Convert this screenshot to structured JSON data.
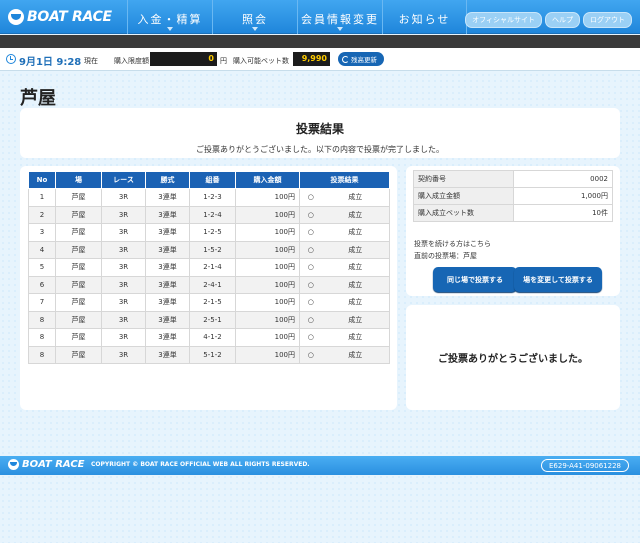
{
  "header": {
    "logo_text": "BOAT RACE",
    "nav": [
      {
        "label": "入金・精算",
        "caret": true
      },
      {
        "label": "照会",
        "caret": true
      },
      {
        "label": "会員情報変更",
        "caret": true
      },
      {
        "label": "お知らせ",
        "caret": false
      }
    ],
    "util": [
      "オフィシャルサイト",
      "ヘルプ",
      "ログアウト"
    ]
  },
  "infobar": {
    "datetime": "9月1日 9:28",
    "datetime_suffix": "現在",
    "limit_label": "購入限度額",
    "limit_value": "0",
    "limit_unit": "円",
    "bets_label": "購入可能ベット数",
    "bets_value": "9,990",
    "refresh_label": "残高更新"
  },
  "page_title": "芦屋",
  "result": {
    "title": "投票結果",
    "message": "ご投票ありがとうございました。以下の内容で投票が完了しました。"
  },
  "table": {
    "headers": [
      "No",
      "場",
      "レース",
      "勝式",
      "組番",
      "購入金額",
      "投票結果"
    ],
    "rows": [
      [
        "1",
        "芦屋",
        "3R",
        "3連単",
        "1-2-3",
        "100円",
        "○",
        "成立"
      ],
      [
        "2",
        "芦屋",
        "3R",
        "3連単",
        "1-2-4",
        "100円",
        "○",
        "成立"
      ],
      [
        "3",
        "芦屋",
        "3R",
        "3連単",
        "1-2-5",
        "100円",
        "○",
        "成立"
      ],
      [
        "4",
        "芦屋",
        "3R",
        "3連単",
        "1-5-2",
        "100円",
        "○",
        "成立"
      ],
      [
        "5",
        "芦屋",
        "3R",
        "3連単",
        "2-1-4",
        "100円",
        "○",
        "成立"
      ],
      [
        "6",
        "芦屋",
        "3R",
        "3連単",
        "2-4-1",
        "100円",
        "○",
        "成立"
      ],
      [
        "7",
        "芦屋",
        "3R",
        "3連単",
        "2-1-5",
        "100円",
        "○",
        "成立"
      ],
      [
        "8",
        "芦屋",
        "3R",
        "3連単",
        "2-5-1",
        "100円",
        "○",
        "成立"
      ],
      [
        "8",
        "芦屋",
        "3R",
        "3連単",
        "4-1-2",
        "100円",
        "○",
        "成立"
      ],
      [
        "8",
        "芦屋",
        "3R",
        "3連単",
        "5-1-2",
        "100円",
        "○",
        "成立"
      ]
    ]
  },
  "summary": {
    "rows": [
      {
        "label": "契約番号",
        "value": "0002"
      },
      {
        "label": "購入成立金額",
        "value": "1,000円"
      },
      {
        "label": "購入成立ベット数",
        "value": "10件"
      }
    ],
    "continue_note": "投票を続ける方はこちら",
    "last_venue_label": "直前の投票場：",
    "last_venue": "芦屋",
    "btn_same": "同じ場で投票する",
    "btn_change": "場を変更して投票する"
  },
  "thanks": "ご投票ありがとうございました。",
  "footer": {
    "logo_text": "BOAT RACE",
    "copyright": "COPYRIGHT © BOAT RACE OFFICIAL WEB ALL RIGHTS RESERVED.",
    "code": "E629-A41-09061228"
  },
  "colors": {
    "accent": "#1f86db",
    "table_header": "#1b62b4",
    "button": "#1766b4"
  }
}
